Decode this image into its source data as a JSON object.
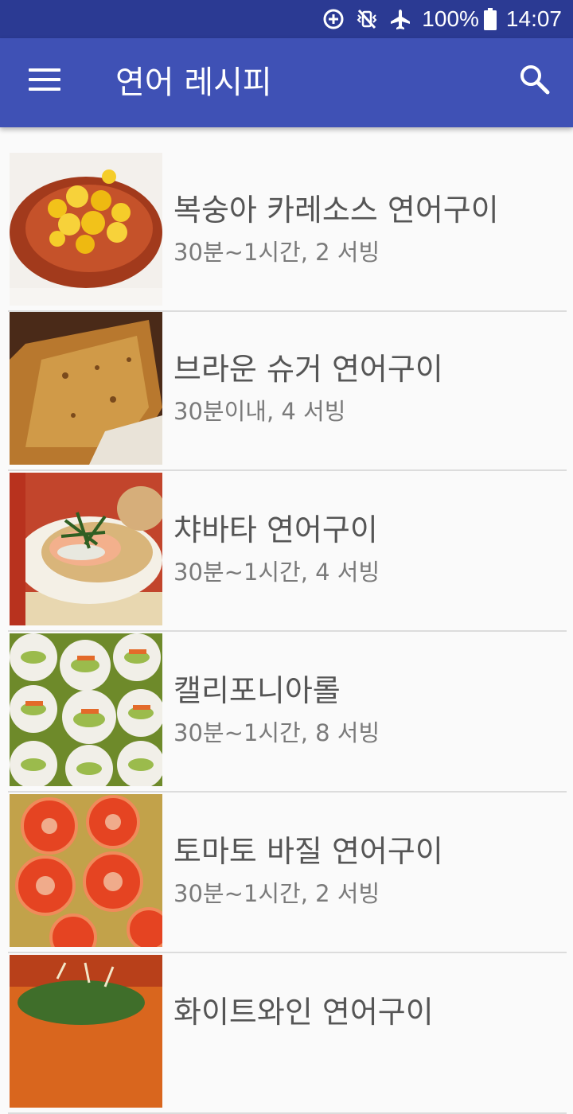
{
  "status_bar": {
    "battery": "100%",
    "time": "14:07",
    "icons": [
      "data-saver-icon",
      "vibrate-off-icon",
      "airplane-icon",
      "battery-icon"
    ]
  },
  "app_bar": {
    "title": "연어 레시피",
    "menu_icon": "hamburger-menu-icon",
    "search_icon": "search-icon",
    "color": "#3f51b5",
    "status_color": "#2b3a93"
  },
  "recipes": [
    {
      "name": "복숭아 카레소스 연어구이",
      "meta": "30분~1시간, 2 서빙"
    },
    {
      "name": "브라운 슈거 연어구이",
      "meta": "30분이내, 4 서빙"
    },
    {
      "name": "챠바타 연어구이",
      "meta": "30분~1시간, 4 서빙"
    },
    {
      "name": "캘리포니아롤",
      "meta": "30분~1시간, 8 서빙"
    },
    {
      "name": "토마토 바질 연어구이",
      "meta": "30분~1시간, 2 서빙"
    },
    {
      "name": "화이트와인 연어구이",
      "meta": ""
    }
  ]
}
